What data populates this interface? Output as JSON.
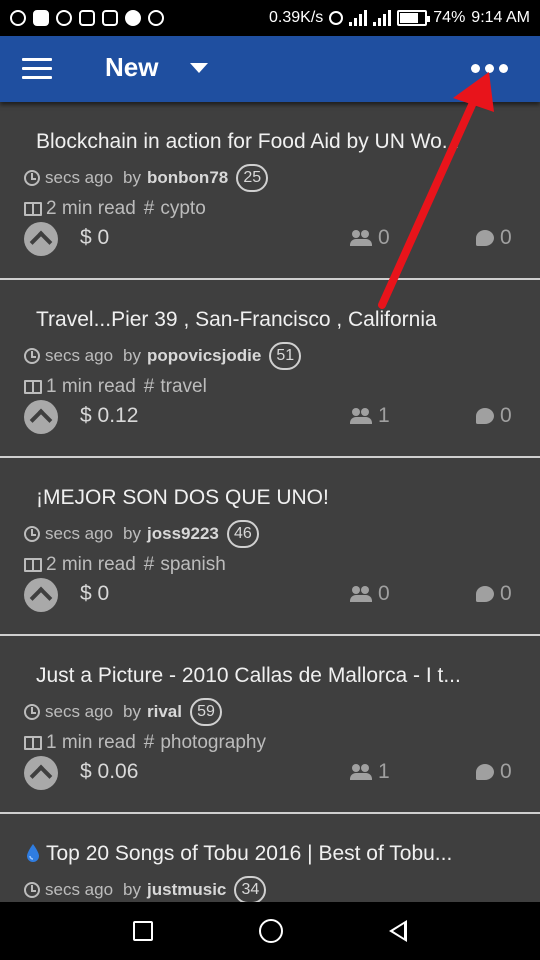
{
  "status_bar": {
    "speed": "0.39K/s",
    "battery": "74%",
    "time": "9:14 AM",
    "battery_level": 0.74
  },
  "app_bar": {
    "title": "New",
    "menu_icon": "hamburger-icon",
    "more_icon": "more-dots-icon",
    "color": "#1f4fa0"
  },
  "posts": [
    {
      "title": "Blockchain in action for Food Aid by UN Wo...",
      "time": "secs ago",
      "by": "by",
      "author": "bonbon78",
      "reputation": "25",
      "read_time": "2 min read",
      "tag": "cypto",
      "payout": "$ 0",
      "voters": "0",
      "comments": "0"
    },
    {
      "title": "Travel...Pier 39 , San-Francisco , California",
      "time": "secs ago",
      "by": "by",
      "author": "popovicsjodie",
      "reputation": "51",
      "read_time": "1 min read",
      "tag": "travel",
      "payout": "$ 0.12",
      "voters": "1",
      "comments": "0"
    },
    {
      "title": "¡MEJOR SON DOS QUE UNO!",
      "time": "secs ago",
      "by": "by",
      "author": "joss9223",
      "reputation": "46",
      "read_time": "2 min read",
      "tag": "spanish",
      "payout": "$ 0",
      "voters": "0",
      "comments": "0"
    },
    {
      "title": "Just a Picture - 2010 Callas de Mallorca - I t...",
      "time": "secs ago",
      "by": "by",
      "author": "rival",
      "reputation": "59",
      "read_time": "1 min read",
      "tag": "photography",
      "payout": "$ 0.06",
      "voters": "1",
      "comments": "0"
    },
    {
      "title": "Top 20 Songs of Tobu 2016 | Best of Tobu...",
      "time": "secs ago",
      "by": "by",
      "author": "justmusic",
      "reputation": "34",
      "icon": "promoted-drop-icon"
    }
  ],
  "hash_symbol": "#",
  "annotation": {
    "color": "#e8141b"
  }
}
